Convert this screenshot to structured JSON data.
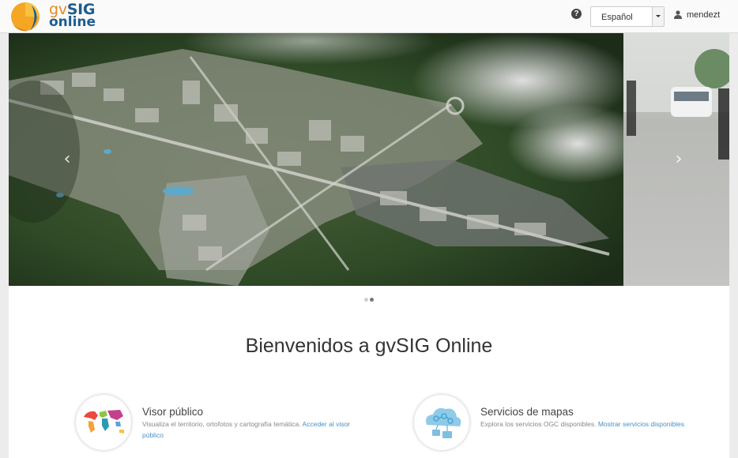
{
  "header": {
    "logo_word_a": "gv",
    "logo_word_b": "SIG",
    "logo_word_c": "online",
    "help_icon": "question-circle-icon",
    "language": {
      "selected": "Español"
    },
    "user": {
      "name": "mendezt",
      "icon": "user-icon"
    }
  },
  "carousel": {
    "prev_icon": "chevron-left-icon",
    "next_icon": "chevron-right-icon",
    "slides": 2,
    "active_slide": 2
  },
  "main": {
    "welcome": "Bienvenidos a gvSIG Online",
    "features": [
      {
        "title": "Visor público",
        "description": "Visualiza el territorio, ortofotos y cartografía temática.",
        "link": "Acceder al visor público",
        "icon": "world-map-icon"
      },
      {
        "title": "Servicios de mapas",
        "description": "Explora los servicios OGC disponibles.",
        "link": "Mostrar servicios disponibles",
        "icon": "cloud-services-icon"
      }
    ]
  },
  "colors": {
    "brand_orange": "#e98a1f",
    "brand_blue": "#1d5d8e",
    "link": "#4a8fc6"
  }
}
